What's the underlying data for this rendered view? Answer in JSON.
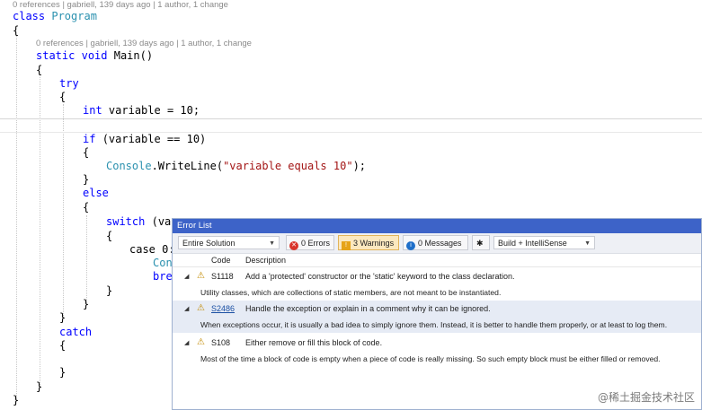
{
  "code": {
    "lens_class": "0 references | gabriell, 139 days ago | 1 author, 1 change",
    "lens_main": "0 references | gabriell, 139 days ago | 1 author, 1 change",
    "l_class_kw": "class",
    "l_class_name": "Program",
    "brace_open": "{",
    "brace_close": "}",
    "l_static": "static",
    "l_void": "void",
    "l_main": "Main()",
    "l_try": "try",
    "l_int": "int",
    "l_var_assign": "variable = 10;",
    "l_if": "if",
    "l_if_cond": "(variable == 10)",
    "l_console": "Console",
    "l_writeline": ".WriteLine(",
    "l_string": "\"variable equals 10\"",
    "l_close": ");",
    "l_else": "else",
    "l_switch": "switch",
    "l_switch_rest": "(var",
    "l_case": "case 0:",
    "l_con": "Con",
    "l_bre": "bre",
    "l_catch": "catch"
  },
  "error_list": {
    "title": "Error List",
    "scope": "Entire Solution",
    "errors": "0 Errors",
    "warnings": "3 Warnings",
    "messages": "0 Messages",
    "build": "Build + IntelliSense",
    "col_code": "Code",
    "col_desc": "Description",
    "rows": [
      {
        "code": "S1118",
        "description": "Add a 'protected' constructor or the 'static' keyword to the class declaration.",
        "detail": "Utility classes, which are collections of static members, are not meant to be instantiated."
      },
      {
        "code": "S2486",
        "description": "Handle the exception or explain in a comment why it can be ignored.",
        "detail": "When exceptions occur, it is usually a bad idea to simply ignore them. Instead, it is better to handle them properly, or at least to log them."
      },
      {
        "code": "S108",
        "description": "Either remove or fill this block of code.",
        "detail": "Most of the time a block of code is empty when a piece of code is really missing. So such empty block must be either filled or removed."
      }
    ]
  },
  "watermark": "@稀土掘金技术社区",
  "colors": {
    "keyword": "#0000ff",
    "type": "#2b91af",
    "string": "#a31515",
    "title_bar": "#3d63c8",
    "warning": "#c28a00"
  }
}
